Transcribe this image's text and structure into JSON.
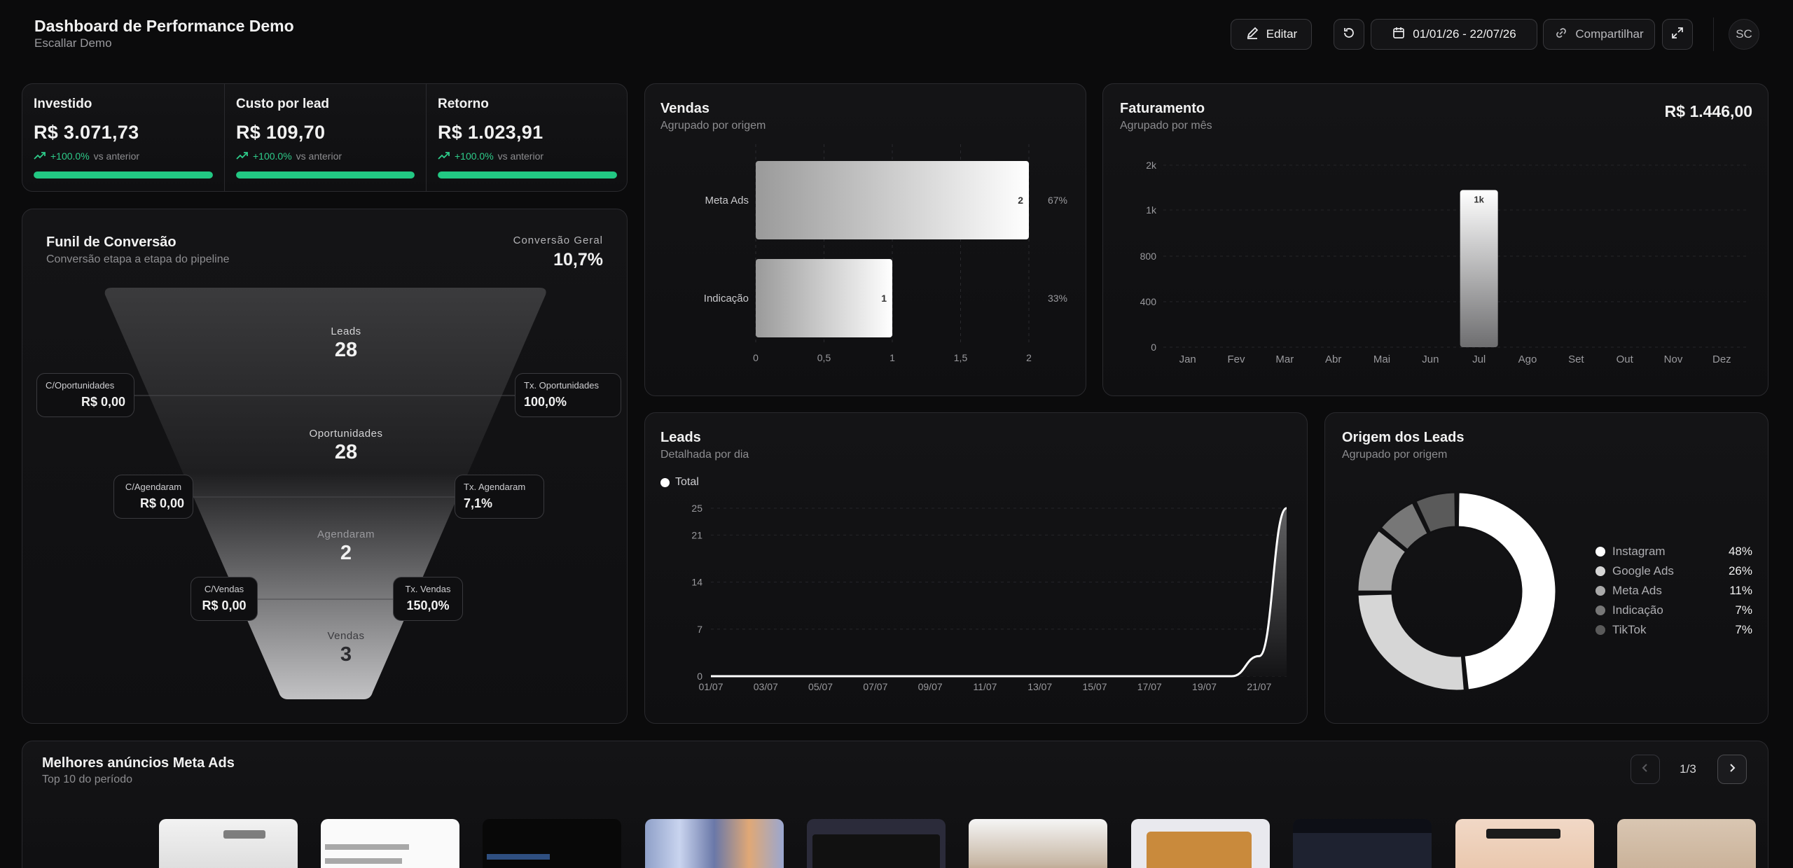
{
  "header": {
    "title": "Dashboard de Performance Demo",
    "subtitle": "Escallar Demo",
    "edit_label": "Editar",
    "date_range": "01/01/26 - 22/07/26",
    "share_label": "Compartilhar",
    "avatar_initials": "SC"
  },
  "kpis": [
    {
      "label": "Investido",
      "value": "R$ 3.071,73",
      "delta": "+100.0%",
      "delta_suffix": "vs anterior",
      "progress": 1.0
    },
    {
      "label": "Custo por lead",
      "value": "R$ 109,70",
      "delta": "+100.0%",
      "delta_suffix": "vs anterior",
      "progress": 1.0
    },
    {
      "label": "Retorno",
      "value": "R$ 1.023,91",
      "delta": "+100.0%",
      "delta_suffix": "vs anterior",
      "progress": 1.0
    }
  ],
  "funnel": {
    "title": "Funil de Conversão",
    "subtitle": "Conversão etapa a etapa do pipeline",
    "overall_label": "Conversão Geral",
    "overall_value": "10,7%",
    "stages": [
      {
        "label": "Leads",
        "value": "28"
      },
      {
        "label": "Oportunidades",
        "value": "28"
      },
      {
        "label": "Agendaram",
        "value": "2"
      },
      {
        "label": "Vendas",
        "value": "3"
      }
    ],
    "costs": [
      {
        "label": "C/Oportunidades",
        "value": "R$ 0,00"
      },
      {
        "label": "C/Agendaram",
        "value": "R$ 0,00"
      },
      {
        "label": "C/Vendas",
        "value": "R$ 0,00"
      }
    ],
    "rates": [
      {
        "label": "Tx. Oportunidades",
        "value": "100,0%"
      },
      {
        "label": "Tx. Agendaram",
        "value": "7,1%"
      },
      {
        "label": "Tx. Vendas",
        "value": "150,0%"
      }
    ]
  },
  "vendas": {
    "title": "Vendas",
    "subtitle": "Agrupado por origem",
    "chart_data": {
      "type": "bar",
      "orientation": "horizontal",
      "categories": [
        "Meta Ads",
        "Indicação"
      ],
      "values": [
        2,
        1
      ],
      "percent_labels": [
        "67%",
        "33%"
      ],
      "value_labels": [
        "2",
        "1"
      ],
      "xlim": [
        0,
        2
      ],
      "x_ticks": [
        "0",
        "0,5",
        "1",
        "1,5",
        "2"
      ],
      "grid": true
    }
  },
  "faturamento": {
    "title": "Faturamento",
    "subtitle": "Agrupado por mês",
    "total": "R$ 1.446,00",
    "chart_data": {
      "type": "bar",
      "categories": [
        "Jan",
        "Fev",
        "Mar",
        "Abr",
        "Mai",
        "Jun",
        "Jul",
        "Ago",
        "Set",
        "Out",
        "Nov",
        "Dez"
      ],
      "values": [
        0,
        0,
        0,
        0,
        0,
        0,
        1446,
        0,
        0,
        0,
        0,
        0
      ],
      "value_labels": [
        "",
        "",
        "",
        "",
        "",
        "",
        "1k",
        "",
        "",
        "",
        "",
        ""
      ],
      "y_ticks": [
        "0",
        "400",
        "800",
        "1k",
        "2k"
      ],
      "y_tick_values": [
        0,
        400,
        800,
        1000,
        2000
      ],
      "grid": true
    }
  },
  "leads": {
    "title": "Leads",
    "subtitle": "Detalhada por dia",
    "chart_data": {
      "type": "line",
      "series": [
        {
          "name": "Total",
          "color": "#ffffff"
        }
      ],
      "x": [
        "01/07",
        "02/07",
        "03/07",
        "04/07",
        "05/07",
        "06/07",
        "07/07",
        "08/07",
        "09/07",
        "10/07",
        "11/07",
        "12/07",
        "13/07",
        "14/07",
        "15/07",
        "16/07",
        "17/07",
        "18/07",
        "19/07",
        "20/07",
        "21/07",
        "22/07"
      ],
      "y": [
        0,
        0,
        0,
        0,
        0,
        0,
        0,
        0,
        0,
        0,
        0,
        0,
        0,
        0,
        0,
        0,
        0,
        0,
        0,
        0,
        3,
        25
      ],
      "x_ticks": [
        "01/07",
        "03/07",
        "05/07",
        "07/07",
        "09/07",
        "11/07",
        "13/07",
        "15/07",
        "17/07",
        "19/07",
        "21/07"
      ],
      "y_ticks": [
        "0",
        "7",
        "14",
        "21",
        "25"
      ],
      "y_tick_values": [
        0,
        7,
        14,
        21,
        25
      ],
      "ylim": [
        0,
        25
      ],
      "legend": "top-left"
    }
  },
  "origem": {
    "title": "Origem dos Leads",
    "subtitle": "Agrupado por origem",
    "chart_data": {
      "type": "pie",
      "donut": true,
      "labels": [
        "Instagram",
        "Google Ads",
        "Meta Ads",
        "Indicação",
        "TikTok"
      ],
      "values": [
        48,
        26,
        11,
        7,
        7
      ],
      "percent_labels": [
        "48%",
        "26%",
        "11%",
        "7%",
        "7%"
      ],
      "colors": [
        "#ffffff",
        "#d6d6d6",
        "#a9a9a9",
        "#777777",
        "#5a5a5a"
      ],
      "legend": "right"
    }
  },
  "ads": {
    "title": "Melhores anúncios Meta Ads",
    "subtitle": "Top 10 do período",
    "page_indicator": "1/3"
  },
  "colors": {
    "accent": "#22c883",
    "background": "#0b0b0c",
    "card": "#141416",
    "border": "#2a2a2e"
  }
}
